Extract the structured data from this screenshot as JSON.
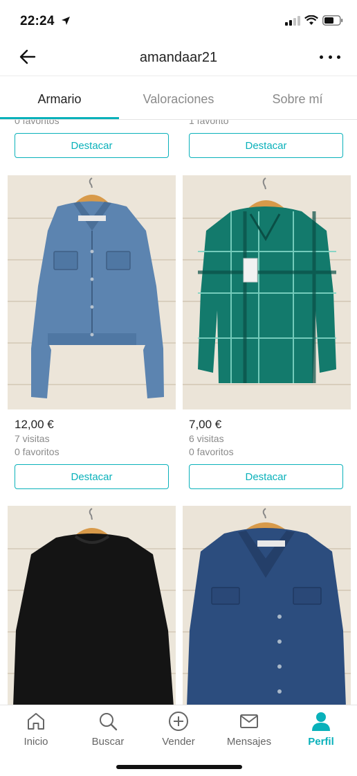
{
  "status_bar": {
    "time": "22:24"
  },
  "header": {
    "title": "amandaar21",
    "back_icon": "arrow-left-icon",
    "more_icon": "more-horizontal-icon"
  },
  "tabs": [
    {
      "label": "Armario",
      "active": true
    },
    {
      "label": "Valoraciones",
      "active": false
    },
    {
      "label": "Sobre mí",
      "active": false
    }
  ],
  "top_row": [
    {
      "favorites": "0 favoritos",
      "button": "Destacar"
    },
    {
      "favorites": "1 favorito",
      "button": "Destacar"
    }
  ],
  "items": [
    {
      "price": "12,00 €",
      "views": "7 visitas",
      "favorites": "0 favoritos",
      "button": "Destacar",
      "photo": "denim-jacket-photo"
    },
    {
      "price": "7,00 €",
      "views": "6 visitas",
      "favorites": "0 favoritos",
      "button": "Destacar",
      "photo": "green-plaid-shirt-photo"
    },
    {
      "photo": "black-sweatshirt-photo"
    },
    {
      "photo": "navy-jacket-photo"
    }
  ],
  "bottom_nav": [
    {
      "label": "Inicio",
      "icon": "home-icon",
      "active": false
    },
    {
      "label": "Buscar",
      "icon": "search-icon",
      "active": false
    },
    {
      "label": "Vender",
      "icon": "plus-circle-icon",
      "active": false
    },
    {
      "label": "Mensajes",
      "icon": "mail-icon",
      "active": false
    },
    {
      "label": "Perfil",
      "icon": "person-icon",
      "active": true
    }
  ],
  "colors": {
    "accent": "#09b1ba",
    "text": "#222222",
    "muted": "#8a8a8a"
  }
}
